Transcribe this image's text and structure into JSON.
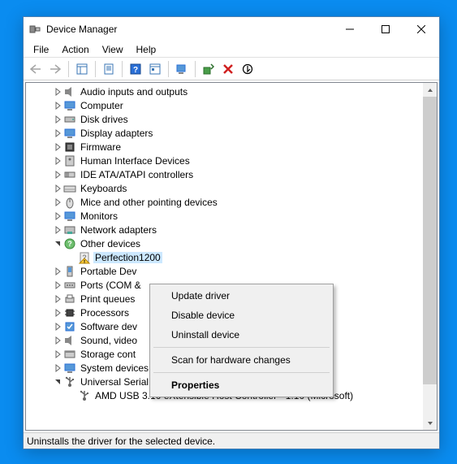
{
  "window": {
    "title": "Device Manager"
  },
  "menubar": {
    "file": "File",
    "action": "Action",
    "view": "View",
    "help": "Help"
  },
  "tree": {
    "items": [
      {
        "label": "Audio inputs and outputs",
        "icon": "speaker",
        "expanded": false
      },
      {
        "label": "Computer",
        "icon": "monitor",
        "expanded": false
      },
      {
        "label": "Disk drives",
        "icon": "disk",
        "expanded": false
      },
      {
        "label": "Display adapters",
        "icon": "monitor",
        "expanded": false
      },
      {
        "label": "Firmware",
        "icon": "chip",
        "expanded": false
      },
      {
        "label": "Human Interface Devices",
        "icon": "hid",
        "expanded": false
      },
      {
        "label": "IDE ATA/ATAPI controllers",
        "icon": "ide",
        "expanded": false
      },
      {
        "label": "Keyboards",
        "icon": "keyboard",
        "expanded": false
      },
      {
        "label": "Mice and other pointing devices",
        "icon": "mouse",
        "expanded": false
      },
      {
        "label": "Monitors",
        "icon": "monitor",
        "expanded": false
      },
      {
        "label": "Network adapters",
        "icon": "network",
        "expanded": false
      },
      {
        "label": "Other devices",
        "icon": "other",
        "expanded": true,
        "children": [
          {
            "label": "Perfection1200",
            "icon": "unknown",
            "warn": true,
            "selected": true
          }
        ]
      },
      {
        "label": "Portable Dev",
        "icon": "portable",
        "expanded": false
      },
      {
        "label": "Ports (COM &",
        "icon": "port",
        "expanded": false
      },
      {
        "label": "Print queues",
        "icon": "printer",
        "expanded": false
      },
      {
        "label": "Processors",
        "icon": "cpu",
        "expanded": false
      },
      {
        "label": "Software dev",
        "icon": "software",
        "expanded": false
      },
      {
        "label": "Sound, video",
        "icon": "speaker",
        "expanded": false
      },
      {
        "label": "Storage cont",
        "icon": "storage",
        "expanded": false
      },
      {
        "label": "System devices",
        "icon": "system",
        "expanded": false
      },
      {
        "label": "Universal Serial Bus controllers",
        "icon": "usb",
        "expanded": true,
        "children": [
          {
            "label": "AMD USB 3.10 eXtensible Host Controller - 1.10 (Microsoft)",
            "icon": "usb"
          }
        ]
      }
    ]
  },
  "context_menu": {
    "update": "Update driver",
    "disable": "Disable device",
    "uninstall": "Uninstall device",
    "scan": "Scan for hardware changes",
    "properties": "Properties"
  },
  "statusbar": {
    "text": "Uninstalls the driver for the selected device."
  }
}
